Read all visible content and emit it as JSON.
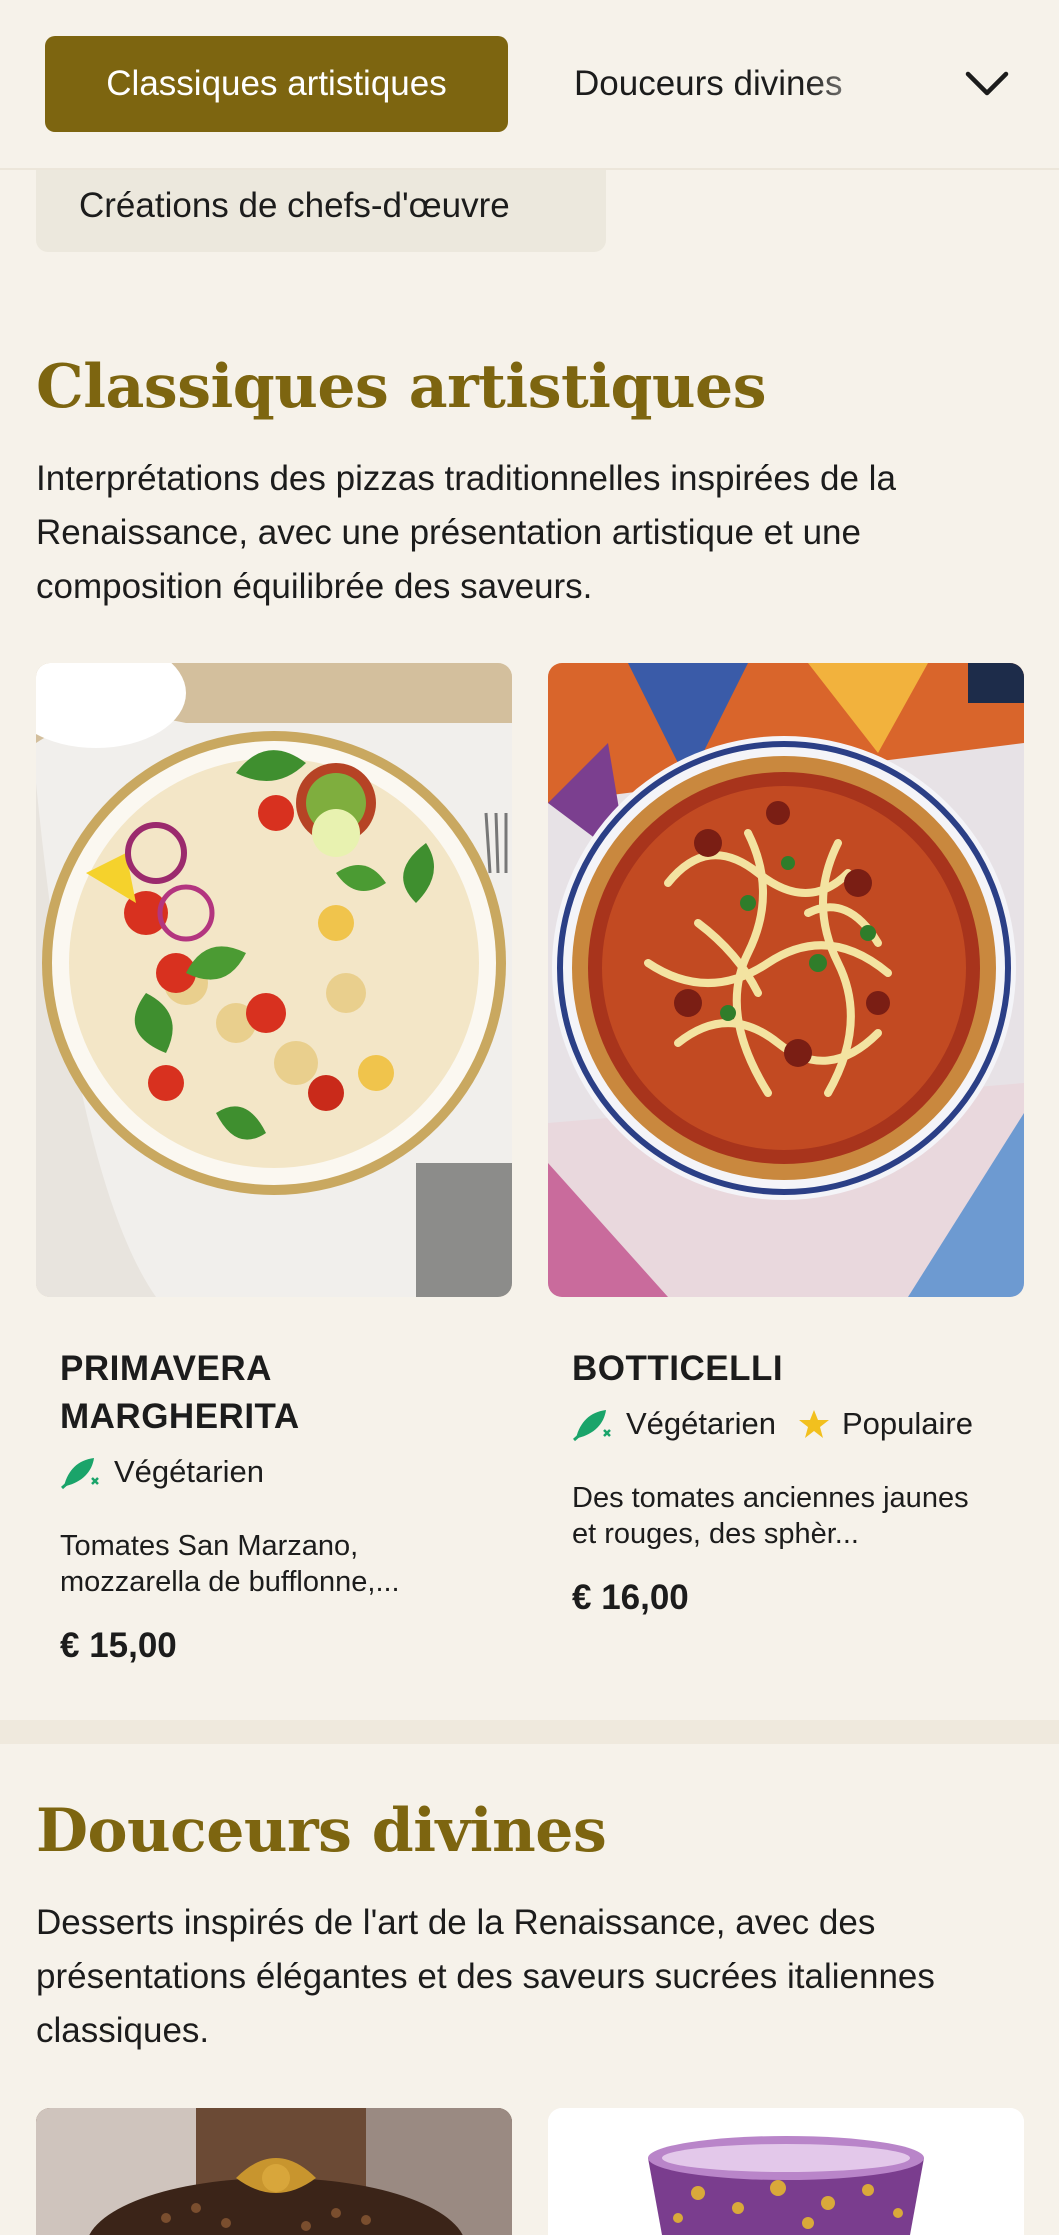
{
  "tabs": {
    "active": "Classiques artistiques",
    "next": "Douceurs divines",
    "overflow": "Créations de chefs-d'œuvre"
  },
  "sections": [
    {
      "title": "Classiques artistiques",
      "description": "Interprétations des pizzas traditionnelles inspirées de la Renaissance, avec une présentation artistique et une composition équilibrée des saveurs.",
      "items": [
        {
          "name": "PRIMAVERA MARGHERITA",
          "tags": [
            "Végétarien"
          ],
          "description": "Tomates San Marzano, mozzarella de bufflonne,...",
          "price": "€ 15,00"
        },
        {
          "name": "BOTTICELLI",
          "tags": [
            "Végétarien",
            "Populaire"
          ],
          "description": "Des tomates anciennes jaunes et rouges, des sphèr...",
          "price": "€ 16,00"
        }
      ]
    },
    {
      "title": "Douceurs divines",
      "description": "Desserts inspirés de l'art de la Renaissance, avec des présentations élégantes et des saveurs sucrées italiennes classiques."
    }
  ],
  "colors": {
    "accent": "#7d6510",
    "background": "#f6f2ea",
    "veg_icon": "#1aa46a",
    "star": "#f2c01e"
  },
  "icons": {
    "chevron": "chevron-down-icon",
    "vegetarian": "leaf-icon",
    "popular": "star-icon"
  }
}
